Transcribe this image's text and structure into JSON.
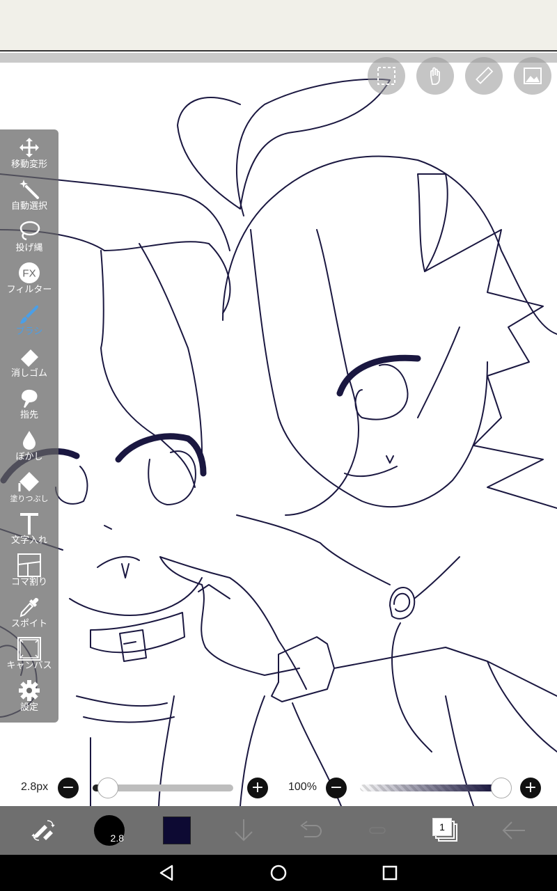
{
  "toolbar": {
    "tools": [
      {
        "label": "移動変形",
        "icon": "move-transform-icon"
      },
      {
        "label": "自動選択",
        "icon": "magic-wand-icon"
      },
      {
        "label": "投げ縄",
        "icon": "lasso-icon"
      },
      {
        "label": "フィルター",
        "icon": "fx-filter-icon"
      },
      {
        "label": "ブラシ",
        "icon": "brush-icon",
        "active": true
      },
      {
        "label": "消しゴム",
        "icon": "eraser-icon"
      },
      {
        "label": "指先",
        "icon": "finger-smudge-icon"
      },
      {
        "label": "ぼかし",
        "icon": "blur-drop-icon"
      },
      {
        "label": "塗りつぶし",
        "icon": "fill-bucket-icon"
      },
      {
        "label": "文字入れ",
        "icon": "text-icon"
      },
      {
        "label": "コマ割り",
        "icon": "frame-divider-icon"
      },
      {
        "label": "スポイト",
        "icon": "eyedropper-icon"
      },
      {
        "label": "キャンバス",
        "icon": "canvas-icon"
      },
      {
        "label": "設定",
        "icon": "gear-icon"
      }
    ],
    "active_color": "#4a9fe8"
  },
  "brush": {
    "size_label": "2.8px",
    "size_fraction": 0.05,
    "opacity_label": "100%",
    "opacity_fraction": 1.0,
    "minus": "−",
    "plus": "+"
  },
  "bottom_bar": {
    "brush_size_badge": "2.8",
    "current_color": "#0d0a33",
    "layer_count": "1"
  },
  "top_tools": [
    "selection-icon",
    "hand-pan-icon",
    "ruler-icon",
    "image-import-icon"
  ],
  "colors": {
    "line": "#1a1740",
    "toolbar_bg": "#646464",
    "bottom_bar_bg": "#6f6f6f"
  }
}
